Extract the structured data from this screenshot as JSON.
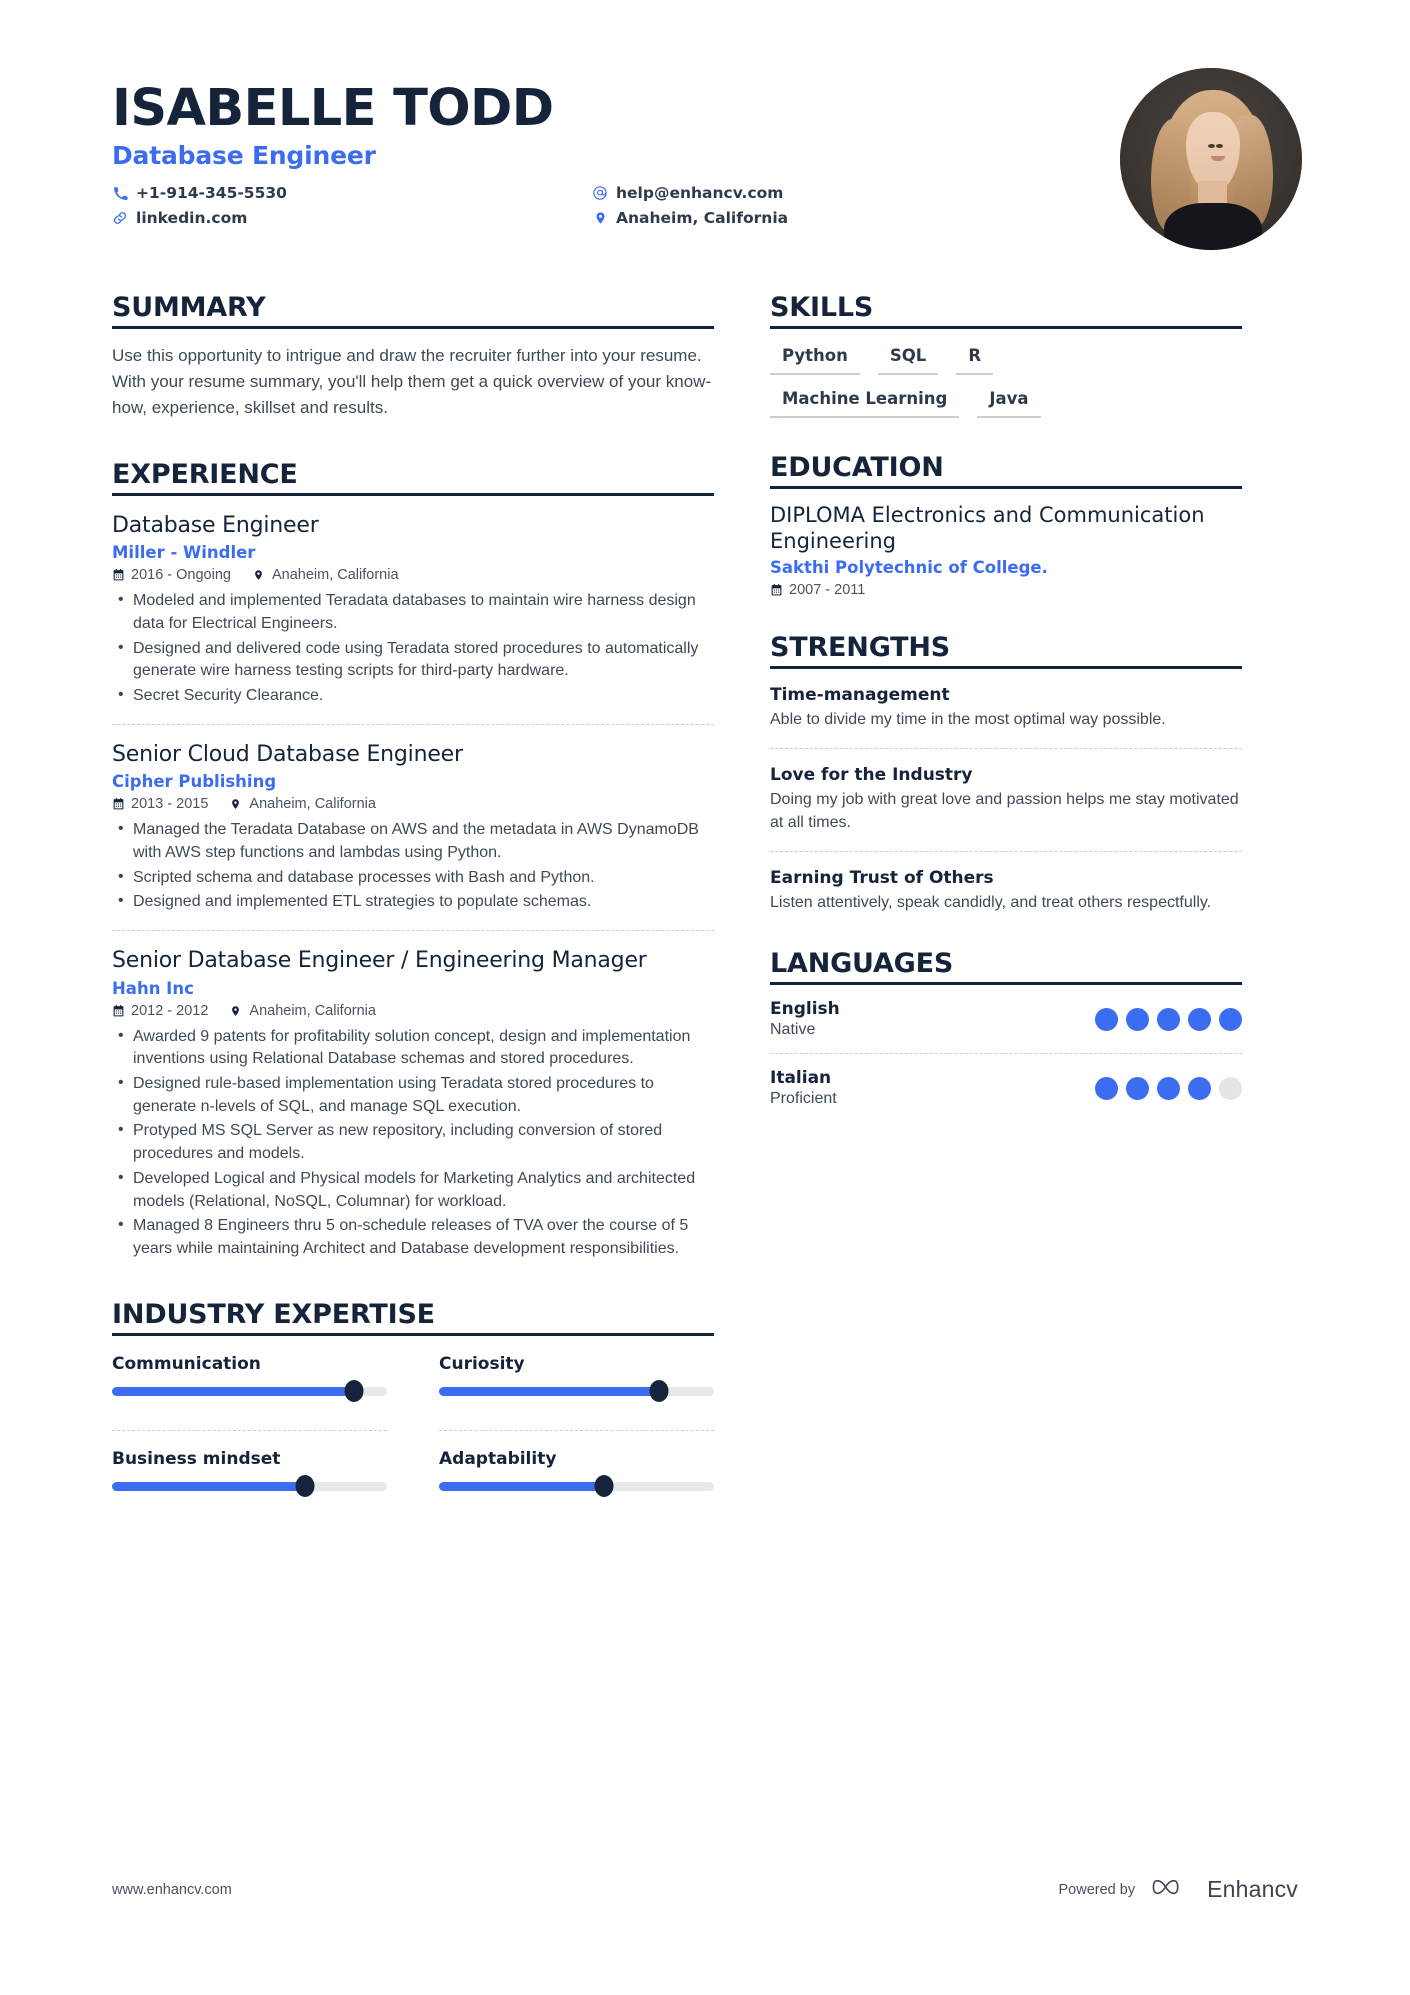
{
  "header": {
    "name": "ISABELLE TODD",
    "role": "Database Engineer",
    "contacts": [
      {
        "icon": "phone-icon",
        "text": "+1-914-345-5530"
      },
      {
        "icon": "email-icon",
        "text": "help@enhancv.com"
      },
      {
        "icon": "link-icon",
        "text": "linkedin.com"
      },
      {
        "icon": "location-icon",
        "text": "Anaheim, California"
      }
    ]
  },
  "summary": {
    "title": "SUMMARY",
    "text": "Use this opportunity to intrigue and draw the recruiter further into your resume. With your resume summary, you'll help them get a quick overview of your know-how, experience, skillset and results."
  },
  "experience": {
    "title": "EXPERIENCE",
    "jobs": [
      {
        "title": "Database Engineer",
        "company": "Miller - Windler",
        "dates": "2016 - Ongoing",
        "location": "Anaheim, California",
        "bullets": [
          "Modeled and implemented Teradata databases to maintain wire harness design data for Electrical Engineers.",
          "Designed and delivered code using Teradata stored procedures to automatically generate wire harness testing scripts for third-party hardware.",
          "Secret Security Clearance."
        ]
      },
      {
        "title": "Senior Cloud Database Engineer",
        "company": "Cipher Publishing",
        "dates": "2013 - 2015",
        "location": "Anaheim, California",
        "bullets": [
          "Managed the Teradata Database on AWS and the metadata in AWS DynamoDB with AWS step functions and lambdas using Python.",
          "Scripted schema and database processes with Bash and Python.",
          "Designed and implemented ETL strategies to populate schemas."
        ]
      },
      {
        "title": "Senior Database Engineer / Engineering Manager",
        "company": "Hahn Inc",
        "dates": "2012 - 2012",
        "location": "Anaheim, California",
        "bullets": [
          "Awarded 9 patents for profitability solution concept, design and implementation inventions using Relational Database schemas and stored procedures.",
          "Designed rule-based implementation using Teradata stored procedures to generate n-levels of SQL, and manage SQL execution.",
          "Protyped MS SQL Server as new repository, including conversion of stored procedures and models.",
          "Developed Logical and Physical models for Marketing Analytics and architected models (Relational, NoSQL, Columnar) for workload.",
          "Managed 8 Engineers thru 5 on-schedule releases of TVA over the course of 5 years while maintaining Architect and Database development responsibilities."
        ]
      }
    ]
  },
  "industry_expertise": {
    "title": "INDUSTRY EXPERTISE",
    "items": [
      {
        "label": "Communication",
        "value": 88
      },
      {
        "label": "Curiosity",
        "value": 80
      },
      {
        "label": "Business mindset",
        "value": 70
      },
      {
        "label": "Adaptability",
        "value": 60
      }
    ]
  },
  "skills": {
    "title": "SKILLS",
    "rows": [
      [
        "Python",
        "SQL",
        "R"
      ],
      [
        "Machine Learning",
        "Java"
      ]
    ]
  },
  "education": {
    "title": "EDUCATION",
    "entries": [
      {
        "degree": "DIPLOMA Electronics and Communication Engineering",
        "school": "Sakthi Polytechnic of College.",
        "dates": "2007 - 2011"
      }
    ]
  },
  "strengths": {
    "title": "STRENGTHS",
    "items": [
      {
        "name": "Time-management",
        "description": "Able to divide my time in the most optimal way possible."
      },
      {
        "name": "Love for the Industry",
        "description": "Doing my job with great love and passion helps me stay motivated at all times."
      },
      {
        "name": "Earning Trust of Others",
        "description": "Listen attentively, speak candidly, and treat others respectfully."
      }
    ]
  },
  "languages": {
    "title": "LANGUAGES",
    "items": [
      {
        "name": "English",
        "level": "Native",
        "dots": 5,
        "total": 5
      },
      {
        "name": "Italian",
        "level": "Proficient",
        "dots": 4,
        "total": 5
      }
    ]
  },
  "footer": {
    "url": "www.enhancv.com",
    "powered_by": "Powered by",
    "brand": "Enhancv"
  },
  "colors": {
    "accent": "#3c6df0",
    "dark": "#16243b",
    "body_text": "#3f4956",
    "track": "#e6e8ea"
  }
}
